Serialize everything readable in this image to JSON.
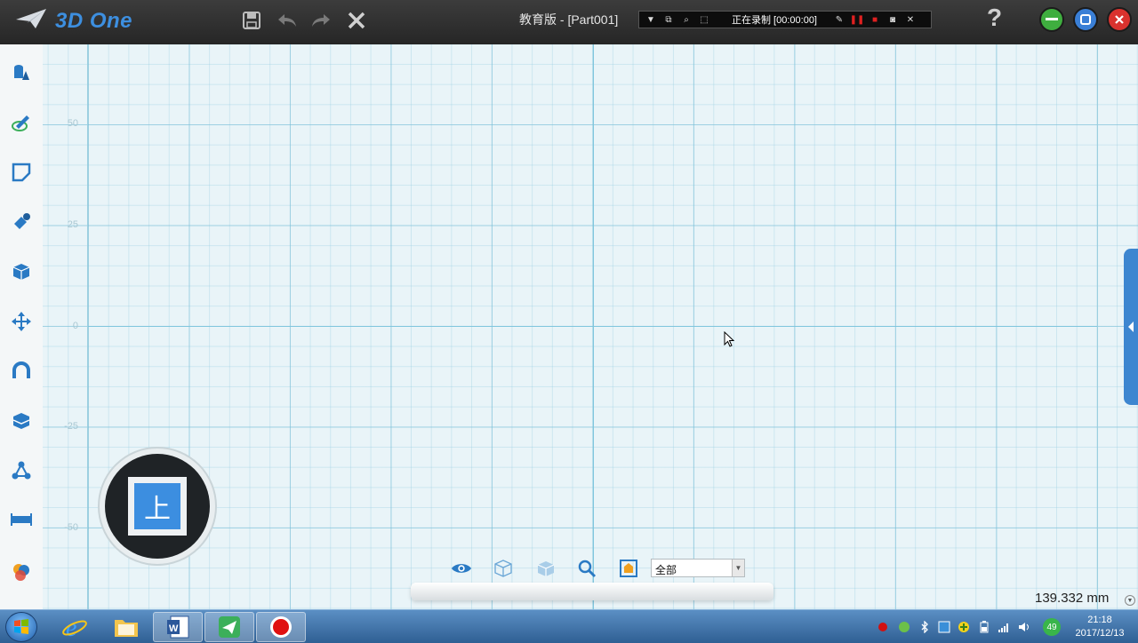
{
  "app": {
    "logo_text": "3D One",
    "document_title": "教育版 - [Part001]",
    "help_label": "?"
  },
  "recorder": {
    "status_text": "正在录制 [00:00:00]"
  },
  "canvas": {
    "y_ticks": [
      "50",
      "25",
      "0",
      "-25",
      "-50"
    ]
  },
  "viewcube": {
    "face_label": "上"
  },
  "view_toolbar": {
    "filter_value": "全部"
  },
  "status": {
    "measurement": "139.332 mm"
  },
  "taskbar": {
    "time": "21:18",
    "date": "2017/12/13",
    "badge": "49"
  },
  "colors": {
    "accent": "#3c8ee0",
    "minimize": "#3fae3f",
    "restore": "#3a7fd6",
    "close": "#d9322e"
  }
}
